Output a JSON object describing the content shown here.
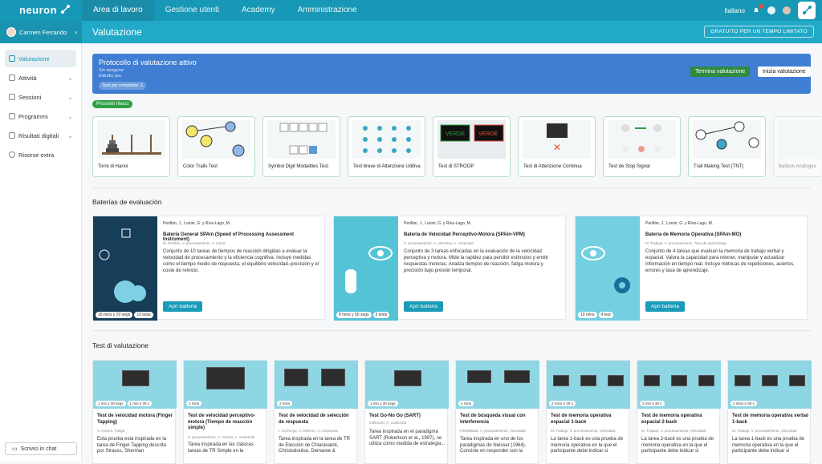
{
  "app": {
    "logo": "neuron"
  },
  "topnav": [
    "Area di lavoro",
    "Gestione utenti",
    "Academy",
    "Amministrazione"
  ],
  "topright": {
    "language": "Italiano"
  },
  "user": {
    "name": "Carmen Ferrando"
  },
  "page": {
    "title": "Valutazione",
    "promo": "GRATUITO PER UN TEMPO LIMITATO"
  },
  "sidebar": {
    "items": [
      {
        "label": "Valutazione"
      },
      {
        "label": "Attività"
      },
      {
        "label": "Sessioni"
      },
      {
        "label": "Programmi"
      },
      {
        "label": "Risultati digitali"
      },
      {
        "label": "Risorse extra"
      }
    ],
    "chat": "Scrivici in chat"
  },
  "banner": {
    "title": "Protocollo di valutazione attivo",
    "line1": "Sin asegurar",
    "line2": "Estudio poc",
    "pill": "Test per completar: 1",
    "stop": "Termina valutazione",
    "start": "Inizia valutazione"
  },
  "recommended": {
    "tag": "Prossimi rilasci",
    "cards": [
      "Torre di Hanoi",
      "Color Trails Test",
      "Symbol Digit Modalities Test",
      "Test breve di Attenzione Uditiva",
      "Test di STROOP",
      "Test di Attenzione Continua",
      "Test de Stop Signal",
      "Trail Making Test (TNT)",
      "Balloon Analogue"
    ]
  },
  "batteries": {
    "title": "Baterías de evaluación",
    "items": [
      {
        "author": "Perillán, J., Lunini, G. y Ríos-Lago, M.",
        "title": "Batería General SPAin (Speed of Processing Assessment Instrument)",
        "meta": "M. Perillán, V. procesamiento, V. motor.",
        "desc": "Conjunto de 10 tareas de tiempos de reacción dirigidas a evaluar la velocidad de procesamiento y la eficiencia cognitiva. Incluye medidas como el tiempo medio de respuesta, el equilibrio velocidad–precisión y el coste de reinicio.",
        "dur": [
          "30 mins y 20 segs",
          "10 tests"
        ],
        "open": "Apri batteria"
      },
      {
        "author": "Perillán, J., Lunini, G. y Ríos-Lago, M.",
        "title": "Batería de Velocidad Perceptivo-Motora (SPAin-VPM)",
        "meta": "V. procesamiento, A. selectiva, A. sostenida",
        "desc": "Conjunto de 3 tareas enfocadas en la evaluación de la velocidad perceptiva y motora. Mide la rapidez para percibir estímulos y emitir respuestas motoras. Analiza tiempos de reacción, fatiga motora y precisión bajo presión temporal.",
        "dur": [
          "8 mins y 50 segs",
          "3 tests"
        ],
        "open": "Apri batteria"
      },
      {
        "author": "Perillán, J., Lunini, G. y Ríos-Lago, M.",
        "title": "Batería de Memoria Operativa (SPAin-MO)",
        "meta": "M. Trabajo, V. procesamiento, Tasa de aprendizaje",
        "desc": "Conjunto de 4 tareas que evalúan la memoria de trabajo verbal y espacial. Valora la capacidad para retener, manipular y actualizar información en tiempo real. Incluye métricas de repeticiones, aciertos, errores y tasa de aprendizaje.",
        "dur": [
          "10 mins",
          "4 test"
        ],
        "open": "Apri batteria"
      }
    ]
  },
  "tests": {
    "title": "Test di valutazione",
    "items": [
      {
        "title": "Test de velocidad motora (Finger Tapping)",
        "meta": "V. motora, Fatiga",
        "desc": "Esta prueba está inspirada en la tarea de Finger Tapping descrita por Strauss, Sherman",
        "dur": [
          "1 min y 30 segs",
          "1 min e 30 s"
        ]
      },
      {
        "title": "Test de velocidad perceptivo-motora (Tiempo de reacción simple)",
        "meta": "V. procesamiento, V. motora, A. sostenida",
        "desc": "Tarea inspirada en las clásicas tareas de TR Simple en la",
        "dur": [
          "2 mins"
        ]
      },
      {
        "title": "Test de velocidad de selección de respuesta",
        "meta": "I. Go/no-go, V. Detecci., A. respuesta",
        "desc": "Tarea inspirada en la tarea de TR de Elección de Chiaravaloti, Christodoulou, Demaree &",
        "dur": [
          "2 mins"
        ]
      },
      {
        "title": "Test Go-No Go (SART)",
        "meta": "Inhibición, A. sostenida",
        "desc": "Tarea inspirada en el paradigma SART (Robertson et al., 1997), se utiliza como medida de estrategia...",
        "dur": [
          "1 min y 30 segs"
        ]
      },
      {
        "title": "Test de búsqueda visual con interferencia",
        "meta": "Flexibilidad, V. procesamiento, Velocidad",
        "desc": "Tarea inspirada en uno de los paradigmas de Neisser (1964). Consiste en responder con la",
        "dur": [
          "4 mins"
        ]
      },
      {
        "title": "Test de memoria operativa espacial 1-back",
        "meta": "M. Trabajo, V. procesamiento, Velocidad",
        "desc": "La tarea 1-back es una prueba de memoria operativa en la que el participante debe indicar si",
        "dur": [
          "2 mins e 30 s"
        ]
      },
      {
        "title": "Test de memoria operativa espacial 2-back",
        "meta": "M. Trabajo, V. procesamiento, Velocidad",
        "desc": "La tarea 2-back es una prueba de memoria operativa en la que el participante debe indicar si",
        "dur": [
          "2 min e 30 s"
        ]
      },
      {
        "title": "Test de memoria operativa verbal 1-back",
        "meta": "M. Trabajo, V. procesamiento, Velocidad",
        "desc": "La tarea 1-back es una prueba de memoria operativa en la que el participante debe indicar si",
        "dur": [
          "2 mins e 30 s"
        ]
      }
    ]
  }
}
